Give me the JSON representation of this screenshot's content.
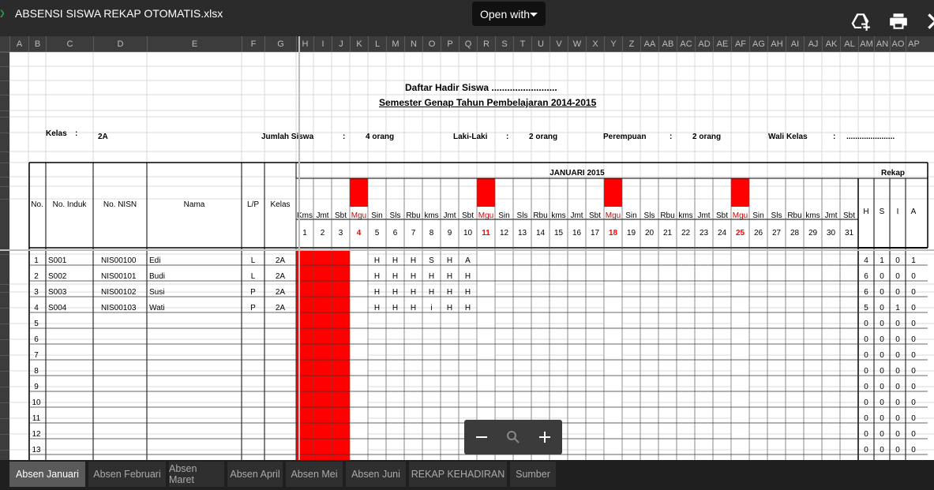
{
  "window": {
    "file_title": "ABSENSI SISWA REKAP OTOMATIS.xlsx",
    "open_with_label": "Open with"
  },
  "toolbar_icons": [
    "add-to-drive-icon",
    "print-icon",
    "close-icon"
  ],
  "column_headers": [
    "A",
    "B",
    "C",
    "D",
    "E",
    "F",
    "G",
    "H",
    "I",
    "J",
    "K",
    "L",
    "M",
    "N",
    "O",
    "P",
    "Q",
    "R",
    "S",
    "T",
    "U",
    "V",
    "W",
    "X",
    "Y",
    "Z",
    "AA",
    "AB",
    "AC",
    "AD",
    "AE",
    "AF",
    "AG",
    "AH",
    "AI",
    "AJ",
    "AK",
    "AL",
    "AM",
    "AN",
    "AO",
    "AP"
  ],
  "sheet": {
    "title": "Daftar Hadir Siswa .........................",
    "subtitle": "Semester Genap Tahun Pembelajaran 2014-2015",
    "info": {
      "kelas_label": "Kelas",
      "colon": ":",
      "kelas_value": "2A",
      "jumlah_label": "Jumlah Siswa",
      "jumlah_value": "4 orang",
      "laki_label": "Laki-Laki",
      "laki_value": "2 orang",
      "perempuan_label": "Perempuan",
      "perempuan_value": "2 orang",
      "wali_label": "Wali Kelas",
      "wali_value": "......................"
    },
    "headers": {
      "no": "No.",
      "induk": "No. Induk",
      "nisn": "No. NISN",
      "nama": "Nama",
      "lp": "L/P",
      "kelas": "Kelas",
      "month": "JANUARI 2015",
      "rekap": "Rekap"
    },
    "days": [
      "Kms",
      "Jmt",
      "Sbt",
      "Mgu",
      "Sin",
      "Sls",
      "Rbu",
      "kms",
      "Jmt",
      "Sbt",
      "Mgu",
      "Sin",
      "Sls",
      "Rbu",
      "kms",
      "Jmt",
      "Sbt",
      "Mgu",
      "Sin",
      "Sls",
      "Rbu",
      "kms",
      "Jmt",
      "Sbt",
      "Mgu",
      "Sin",
      "Sls",
      "Rbu",
      "kms",
      "Jmt",
      "Sbt"
    ],
    "dates": [
      "1",
      "2",
      "3",
      "4",
      "5",
      "6",
      "7",
      "8",
      "9",
      "10",
      "11",
      "12",
      "13",
      "14",
      "15",
      "16",
      "17",
      "18",
      "19",
      "20",
      "21",
      "22",
      "23",
      "24",
      "25",
      "26",
      "27",
      "28",
      "29",
      "30",
      "31"
    ],
    "sundays": [
      "4",
      "11",
      "18",
      "25"
    ],
    "rekap_headers": [
      "H",
      "S",
      "I",
      "A"
    ],
    "students": [
      {
        "no": "1",
        "induk": "S001",
        "nisn": "NIS00100",
        "nama": "Edi",
        "lp": "L",
        "kelas": "2A",
        "att": [
          "H",
          "H",
          "H",
          "S",
          "H",
          "A"
        ],
        "rekap": [
          "4",
          "1",
          "0",
          "1"
        ]
      },
      {
        "no": "2",
        "induk": "S002",
        "nisn": "NIS00101",
        "nama": "Budi",
        "lp": "L",
        "kelas": "2A",
        "att": [
          "H",
          "H",
          "H",
          "H",
          "H",
          "H"
        ],
        "rekap": [
          "6",
          "0",
          "0",
          "0"
        ]
      },
      {
        "no": "3",
        "induk": "S003",
        "nisn": "NIS00102",
        "nama": "Susi",
        "lp": "P",
        "kelas": "2A",
        "att": [
          "H",
          "H",
          "H",
          "H",
          "H",
          "H"
        ],
        "rekap": [
          "6",
          "0",
          "0",
          "0"
        ]
      },
      {
        "no": "4",
        "induk": "S004",
        "nisn": "NIS00103",
        "nama": "Wati",
        "lp": "P",
        "kelas": "2A",
        "att": [
          "H",
          "H",
          "H",
          "i",
          "H",
          "H"
        ],
        "rekap": [
          "5",
          "0",
          "1",
          "0"
        ]
      }
    ],
    "empty_numbers": [
      "5",
      "6",
      "7",
      "8",
      "9",
      "10",
      "11",
      "12",
      "13"
    ],
    "empty_rekap": [
      "0",
      "0",
      "0",
      "0"
    ]
  },
  "sheet_tabs": [
    "Absen Januari",
    "Absen Februari",
    "Absen Maret",
    "Absen April",
    "Absen Mei",
    "Absen Juni",
    "REKAP KEHADIRAN",
    "Sumber"
  ],
  "active_tab": "Absen Januari",
  "colors": {
    "sunday": "#ff0000",
    "weekend_fill": "#ff0000",
    "sunday_text": "#cc0000"
  }
}
